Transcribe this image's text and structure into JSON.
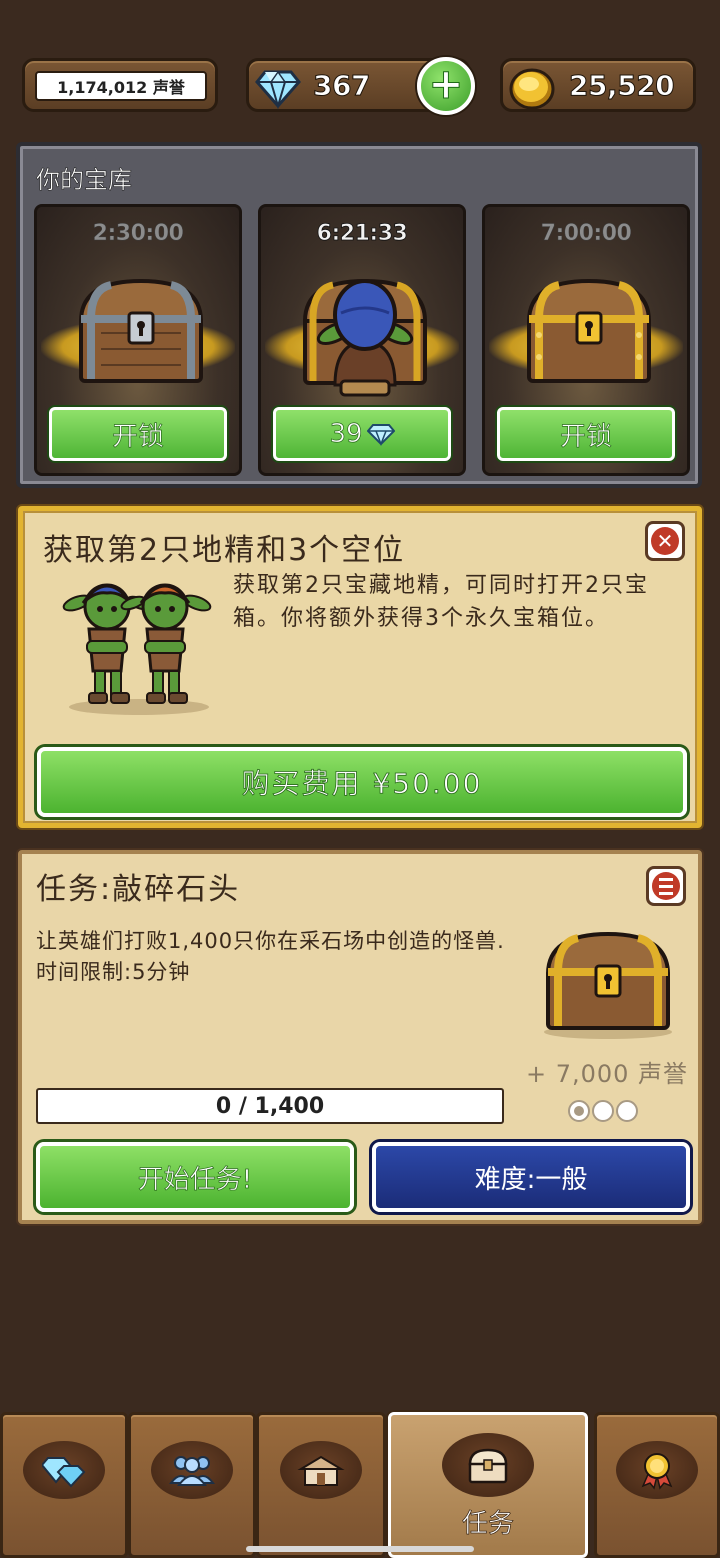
{
  "topbar": {
    "reputation": "1,174,012 声誉",
    "gems": "367",
    "gold": "25,520"
  },
  "vault": {
    "title": "你的宝库",
    "slots": [
      {
        "timer": "2:30:00",
        "button": "开锁",
        "chest": "iron-chest"
      },
      {
        "timer": "6:21:33",
        "button": "39",
        "chest": "goblin-opening-chest"
      },
      {
        "timer": "7:00:00",
        "button": "开锁",
        "chest": "gold-chest"
      }
    ]
  },
  "offer": {
    "title": "获取第2只地精和3个空位",
    "description": "获取第2只宝藏地精，可同时打开2只宝箱。你将额外获得3个永久宝箱位。",
    "buy_label": "购买费用 ¥50.00"
  },
  "quest": {
    "title": "任务:敲碎石头",
    "description": "让英雄们打败1,400只你在采石场中创造的怪兽.时间限制:5分钟",
    "reward": "+ 7,000 声誉",
    "progress_text": "0 / 1,400",
    "progress_value": 0,
    "difficulty_dots": [
      true,
      false,
      false
    ],
    "start_label": "开始任务!",
    "difficulty_label": "难度:一般"
  },
  "nav": {
    "tabs": [
      {
        "icon": "gems-icon",
        "label": ""
      },
      {
        "icon": "heroes-icon",
        "label": ""
      },
      {
        "icon": "buildings-icon",
        "label": ""
      },
      {
        "icon": "quest-chest-icon",
        "label": "任务",
        "active": true
      },
      {
        "icon": "achievement-medal-icon",
        "label": ""
      }
    ]
  },
  "colors": {
    "button_green": "#4cb330",
    "button_blue": "#1b2c78",
    "panel_gold_border": "#e2b431",
    "close_red": "#c03a28"
  }
}
